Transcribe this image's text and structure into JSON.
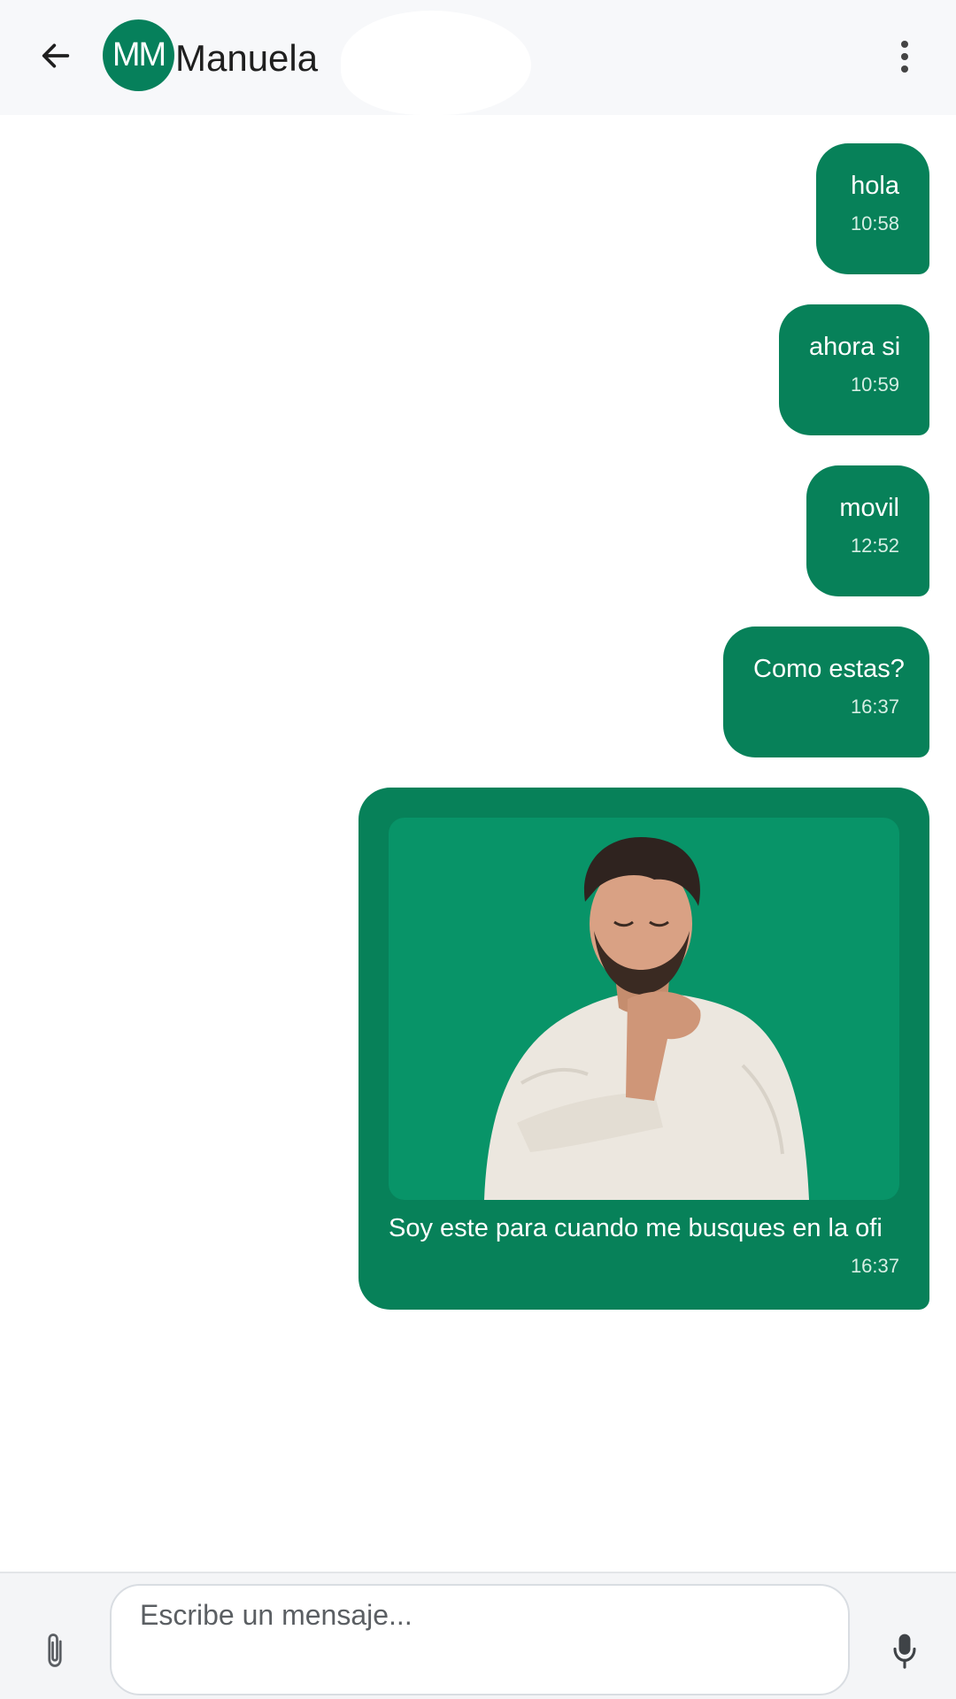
{
  "header": {
    "avatar_initials": "MM",
    "contact_name": "Manuela",
    "back_icon": "arrow-left-icon",
    "menu_icon": "more-vertical-icon"
  },
  "messages": [
    {
      "text": "hola",
      "time": "10:58",
      "outgoing": true
    },
    {
      "text": "ahora si",
      "time": "10:59",
      "outgoing": true
    },
    {
      "text": "movil",
      "time": "12:52",
      "outgoing": true
    },
    {
      "text": "Como estas?",
      "time": "16:37",
      "outgoing": true
    },
    {
      "type": "sticker",
      "caption": "Soy este para cuando me busques en la ofi",
      "time": "16:37",
      "outgoing": true
    }
  ],
  "composer": {
    "placeholder": "Escribe un mensaje...",
    "value": "",
    "attach_icon": "paperclip-icon",
    "mic_icon": "microphone-icon"
  },
  "colors": {
    "accent": "#078159",
    "sticker_bg": "#089468",
    "header_bg": "#f7f8fa",
    "composer_bg": "#f4f5f7"
  }
}
